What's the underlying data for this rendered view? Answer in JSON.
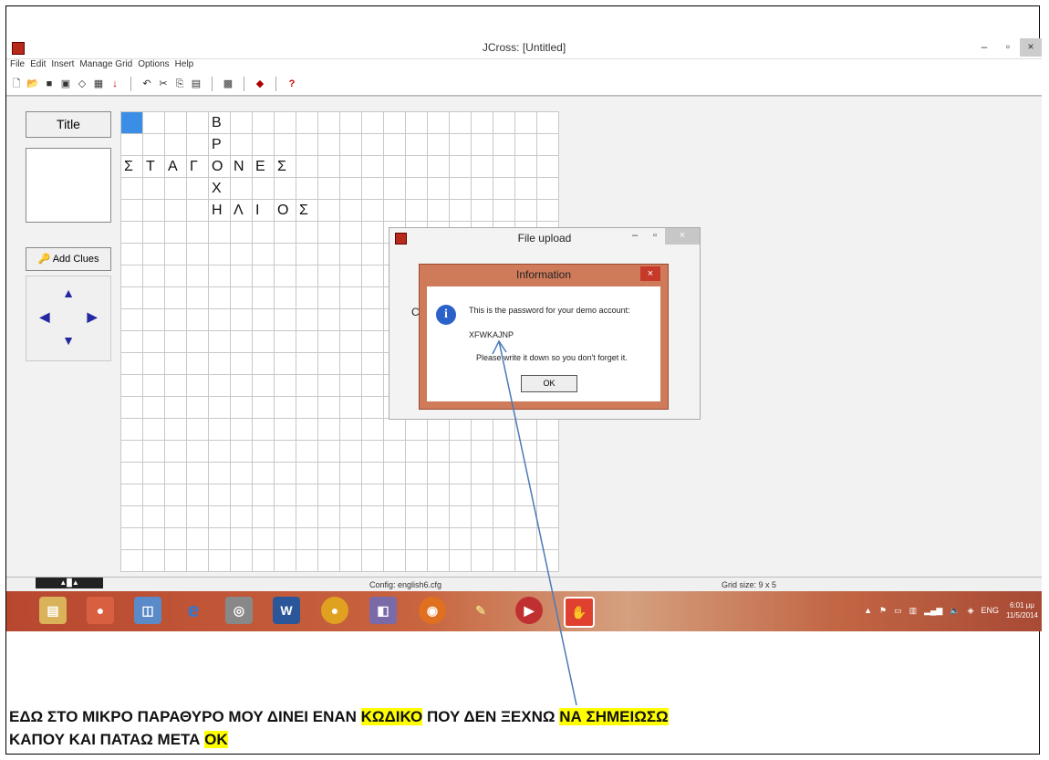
{
  "window": {
    "title": "JCross: [Untitled]",
    "buttons": [
      "–",
      "▫",
      "×"
    ]
  },
  "menu": [
    "File",
    "Edit",
    "Insert",
    "Manage Grid",
    "Options",
    "Help"
  ],
  "sidebar": {
    "title_button": "Title",
    "add_clues_button": "Add Clues"
  },
  "grid": {
    "rows": [
      [
        "",
        "",
        "",
        "",
        "Β",
        "",
        "",
        "",
        "",
        "",
        "",
        "",
        "",
        "",
        "",
        "",
        "",
        "",
        "",
        ""
      ],
      [
        "",
        "",
        "",
        "",
        "Ρ",
        "",
        "",
        "",
        "",
        "",
        "",
        "",
        "",
        "",
        "",
        "",
        "",
        "",
        "",
        ""
      ],
      [
        "Σ",
        "Τ",
        "Α",
        "Γ",
        "Ο",
        "Ν",
        "Ε",
        "Σ",
        "",
        "",
        "",
        "",
        "",
        "",
        "",
        "",
        "",
        "",
        "",
        ""
      ],
      [
        "",
        "",
        "",
        "",
        "Χ",
        "",
        "",
        "",
        "",
        "",
        "",
        "",
        "",
        "",
        "",
        "",
        "",
        "",
        "",
        ""
      ],
      [
        "",
        "",
        "",
        "",
        "Η",
        "Λ",
        "Ι",
        "Ο",
        "Σ",
        "",
        "",
        "",
        "",
        "",
        "",
        "",
        "",
        "",
        "",
        ""
      ]
    ],
    "total_rows": 21
  },
  "file_upload": {
    "title": "File upload",
    "cut_text": "Co"
  },
  "info_dialog": {
    "title": "Information",
    "line1": "This is the password for your demo account:",
    "password": "XFWKAJNP",
    "line2": "Please write it down so you don't forget it.",
    "ok_label": "OK"
  },
  "statusbar": {
    "config": "Config: english6.cfg",
    "grid_size": "Grid size: 9 x 5"
  },
  "tray": {
    "lang": "ENG",
    "time": "6:01 μμ",
    "date": "11/5/2014"
  },
  "caption": {
    "line1_a": "ΕΔΩ ΣΤΟ ΜΙΚΡΟ ΠΑΡΑΘΥΡΟ ΜΟΥ ΔΙΝΕΙ ΕΝΑΝ ",
    "line1_hl1": "ΚΩΔΙΚΟ",
    "line1_b": " ΠΟΥ ΔΕΝ ΞΕΧΝΩ ",
    "line1_hl2": "ΝΑ ΣΗΜΕΙΩΣΩ",
    "line2_a": "ΚΑΠΟΥ ΚΑΙ ΠΑΤΑΩ ΜΕΤΑ ",
    "line2_hl": "ΟΚ"
  }
}
